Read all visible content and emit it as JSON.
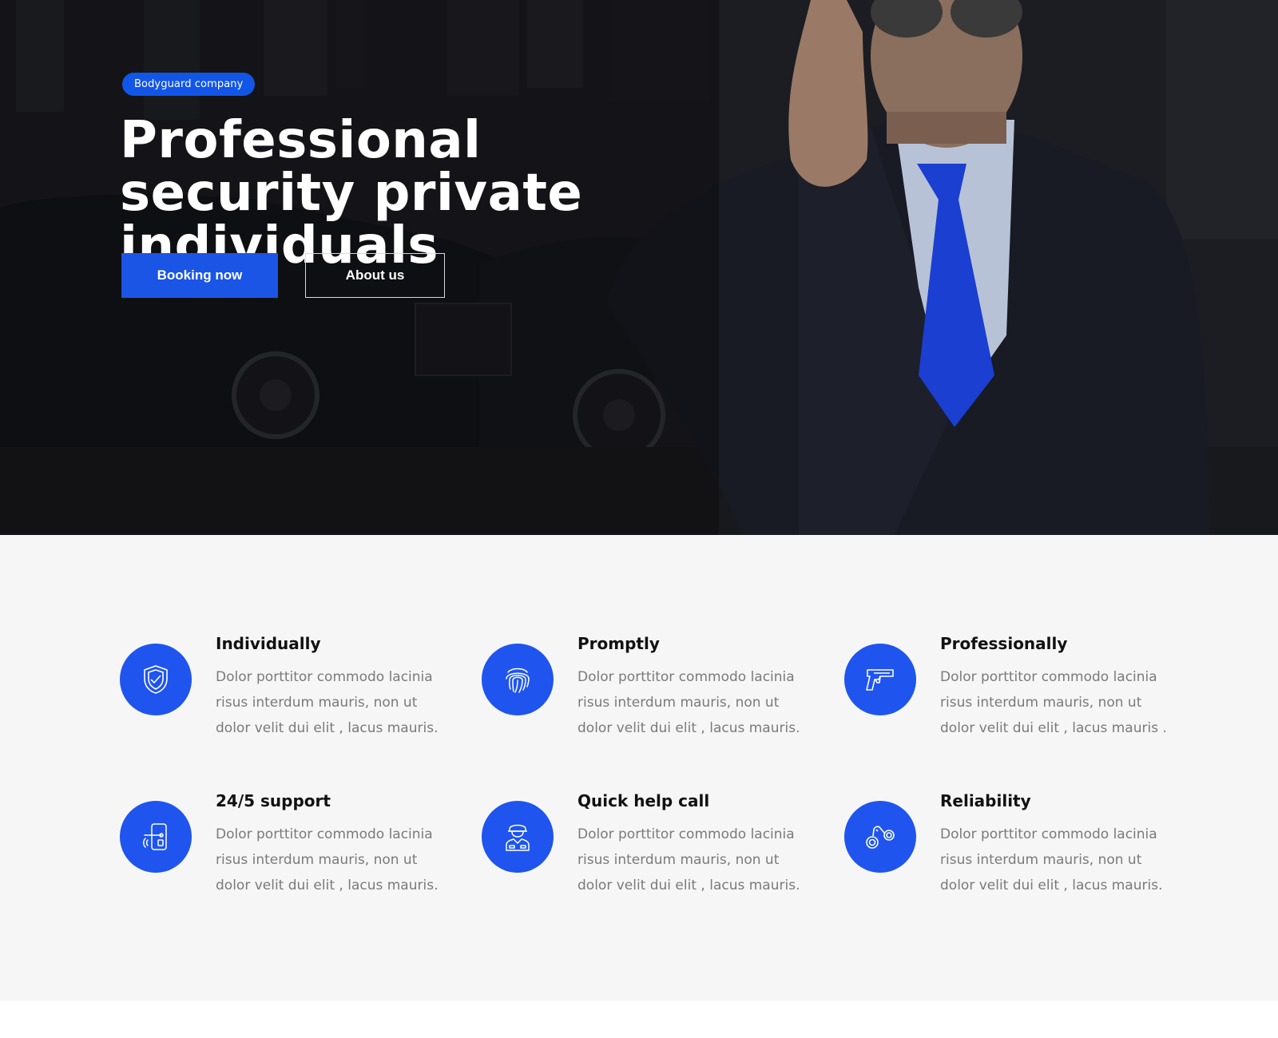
{
  "hero": {
    "badge": "Bodyguard company",
    "title": "Professional security private individuals",
    "primary_button": "Booking now",
    "secondary_button": "About us"
  },
  "features": [
    {
      "title": "Individually",
      "text": "Dolor porttitor commodo lacinia risus interdum mauris, non ut dolor velit dui elit , lacus mauris.",
      "icon": "shield-check-icon"
    },
    {
      "title": "Promptly",
      "text": "Dolor porttitor commodo lacinia risus interdum mauris, non ut dolor velit dui elit , lacus mauris.",
      "icon": "fingerprint-icon"
    },
    {
      "title": "Professionally",
      "text": "Dolor porttitor commodo lacinia risus interdum mauris, non ut dolor velit dui elit , lacus mauris .",
      "icon": "pistol-icon"
    },
    {
      "title": "24/5 support",
      "text": "Dolor porttitor commodo lacinia risus interdum mauris, non ut dolor velit dui elit , lacus mauris.",
      "icon": "smart-lock-icon"
    },
    {
      "title": "Quick help call",
      "text": "Dolor porttitor commodo lacinia risus interdum mauris, non ut dolor velit dui elit , lacus mauris.",
      "icon": "security-guard-icon"
    },
    {
      "title": "Reliability",
      "text": "Dolor porttitor commodo lacinia risus interdum mauris, non ut dolor velit dui elit , lacus mauris.",
      "icon": "handcuffs-icon"
    }
  ],
  "colors": {
    "accent": "#1f55ee",
    "button": "#1a55e6",
    "hero_dark": "#1a1b20",
    "section_bg": "#f6f6f6"
  }
}
